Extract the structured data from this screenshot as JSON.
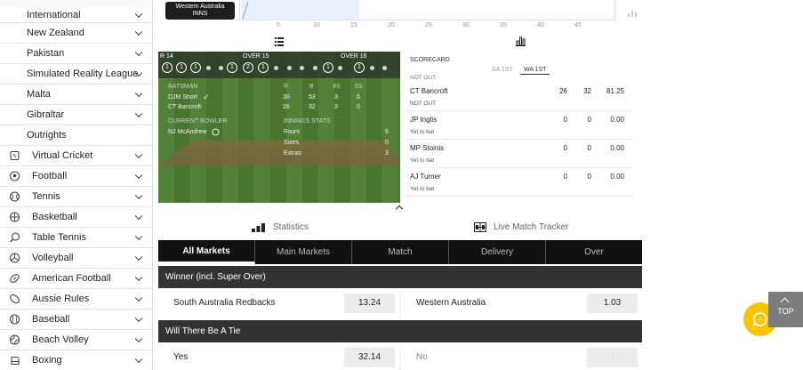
{
  "sidebar": {
    "sub_items": [
      {
        "label": "International"
      },
      {
        "label": "New Zealand"
      },
      {
        "label": "Pakistan"
      },
      {
        "label": "Simulated Reality League"
      },
      {
        "label": "Malta"
      },
      {
        "label": "Gibraltar"
      },
      {
        "label": "Outrights"
      }
    ],
    "sports": [
      {
        "label": "Virtual Cricket",
        "icon": "virtual-cricket-icon"
      },
      {
        "label": "Football",
        "icon": "football-icon"
      },
      {
        "label": "Tennis",
        "icon": "tennis-icon"
      },
      {
        "label": "Basketball",
        "icon": "basketball-icon"
      },
      {
        "label": "Table Tennis",
        "icon": "table-tennis-icon"
      },
      {
        "label": "Volleyball",
        "icon": "volleyball-icon"
      },
      {
        "label": "American Football",
        "icon": "american-football-icon"
      },
      {
        "label": "Aussie Rules",
        "icon": "aussie-rules-icon"
      },
      {
        "label": "Baseball",
        "icon": "baseball-icon"
      },
      {
        "label": "Beach Volley",
        "icon": "beach-volley-icon"
      },
      {
        "label": "Boxing",
        "icon": "boxing-icon"
      }
    ]
  },
  "worm": {
    "team_line1": "Western Australia",
    "team_line2": "INNS",
    "ticks": [
      "5",
      "10",
      "15",
      "20",
      "25",
      "30",
      "35",
      "40",
      "45"
    ]
  },
  "tracker": {
    "overs": {
      "left": "R 14",
      "mid": "OVER 15",
      "right": "OVER 16"
    },
    "balls_left": [
      "1",
      "1",
      "1"
    ],
    "balls_mid": [
      "1",
      "2",
      "1"
    ],
    "balls_right": [
      "1",
      "1"
    ],
    "batsman_header": "BATSMAN",
    "cols": [
      "R",
      "B",
      "4S",
      "6S"
    ],
    "batsmen": [
      {
        "name": "DJM Short",
        "r": "30",
        "b": "53",
        "fours": "3",
        "sixes": "0"
      },
      {
        "name": "CT Bancroft",
        "r": "26",
        "b": "32",
        "fours": "3",
        "sixes": "0"
      }
    ],
    "bowler_header": "CURRENT BOWLER",
    "bowler": "NJ McAndrew",
    "innings_header": "INNINGS STATS",
    "innings": [
      {
        "label": "Fours",
        "value": "6"
      },
      {
        "label": "Sixes",
        "value": "0"
      },
      {
        "label": "Extras",
        "value": "3"
      }
    ]
  },
  "scorecard": {
    "title": "SCORECARD",
    "tabs": [
      "SA 1ST",
      "WA 1ST"
    ],
    "top_cut": "NOT OUT",
    "rows": [
      {
        "name": "CT Bancroft",
        "status": "NOT OUT",
        "r": "26",
        "b": "32",
        "sr": "81.25"
      },
      {
        "name": "JP Inglis",
        "status": "Yet to bat",
        "r": "0",
        "b": "0",
        "sr": "0.00"
      },
      {
        "name": "MP Stoinis",
        "status": "Yet to bat",
        "r": "0",
        "b": "0",
        "sr": "0.00"
      },
      {
        "name": "AJ Turner",
        "status": "Yet to bat",
        "r": "0",
        "b": "0",
        "sr": "0.00"
      }
    ]
  },
  "links": {
    "statistics": "Statistics",
    "tracker": "Live Match Tracker"
  },
  "tabs": [
    "All Markets",
    "Main Markets",
    "Match",
    "Delivery",
    "Over"
  ],
  "markets": [
    {
      "title": "Winner (incl. Super Over)",
      "left": {
        "name": "South Australia Redbacks",
        "odds": "13.24"
      },
      "right": {
        "name": "Western Australia",
        "odds": "1.03"
      }
    },
    {
      "title": "Will There Be A Tie",
      "left": {
        "name": "Yes",
        "odds": "32.14"
      },
      "right": {
        "name": "No",
        "odds": "-"
      }
    }
  ],
  "top_button": "TOP"
}
